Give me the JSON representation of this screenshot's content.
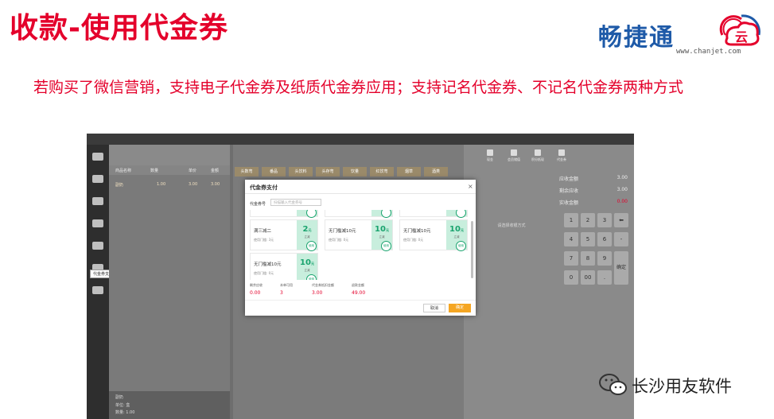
{
  "slide": {
    "title": "收款-使用代金券",
    "description": "若购买了微信营销，支持电子代金券及纸质代金券应用；支持记名代金券、不记名代金券两种方式"
  },
  "logo": {
    "text": "畅捷通",
    "url": "www.chanjet.com",
    "colors": {
      "blue": "#1e5aa8",
      "red": "#e4002b"
    }
  },
  "watermark": {
    "text": "长沙用友软件",
    "icon": "wechat-icon"
  },
  "app": {
    "sidebar_tooltip": "代金券支付",
    "cart": {
      "columns": [
        "商品名称",
        "数量",
        "单价",
        "金额"
      ],
      "row": {
        "name": "副奶",
        "qty": "1.00",
        "price": "3.00",
        "amount": "3.00"
      },
      "footer": {
        "name": "副奶",
        "unit": "单位: 盒",
        "qty": "数量: 1.00"
      }
    },
    "product_tabs": [
      "头数弯",
      "番品",
      "头饮料",
      "头存弯",
      "饮量",
      "红饮弯",
      "烟草",
      "酒类"
    ],
    "payment_icons": [
      "现金",
      "会员储值",
      "积分抵现",
      "代金券"
    ],
    "summary": [
      {
        "label": "应收金额",
        "value": "3.00"
      },
      {
        "label": "剩余应收",
        "value": "3.00"
      },
      {
        "label": "实收金额",
        "value": "0.00"
      }
    ],
    "keypad": [
      "1",
      "2",
      "3",
      "⬅",
      "4",
      "5",
      "6",
      "-",
      "7",
      "8",
      "9",
      "00",
      "0",
      "00",
      "."
    ],
    "confirm_key": "确定",
    "hint": "请选择收银方式"
  },
  "modal": {
    "title": "代金券支付",
    "code_label": "代金券号",
    "code_placeholder": "扫描输入代金券号",
    "cards": [
      {
        "name": "满三减二",
        "cond": "使用门槛: 3元",
        "amount": "2",
        "unit": "元",
        "note": "立减",
        "stamp": "使用"
      },
      {
        "name": "无门槛减10元",
        "cond": "使用门槛: 0元",
        "amount": "10",
        "unit": "元",
        "note": "立减",
        "stamp": "使用"
      },
      {
        "name": "无门槛减10元",
        "cond": "使用门槛: 0元",
        "amount": "10",
        "unit": "元",
        "note": "立减",
        "stamp": "使用"
      },
      {
        "name": "无门槛减10元",
        "cond": "使用门槛: 0元",
        "amount": "10",
        "unit": "元",
        "note": "立减",
        "stamp": "使用"
      }
    ],
    "stats": [
      {
        "label": "剩余应收",
        "value": "0.00"
      },
      {
        "label": "本单可用",
        "value": "3"
      },
      {
        "label": "代金券抵扣金额",
        "value": "3.00"
      },
      {
        "label": "退款金额",
        "value": "49.00"
      }
    ],
    "cancel": "取消",
    "ok": "确定",
    "colors": {
      "accent": "#f5a623",
      "coupon": "#1aa36e",
      "stat": "#e4002b"
    }
  }
}
